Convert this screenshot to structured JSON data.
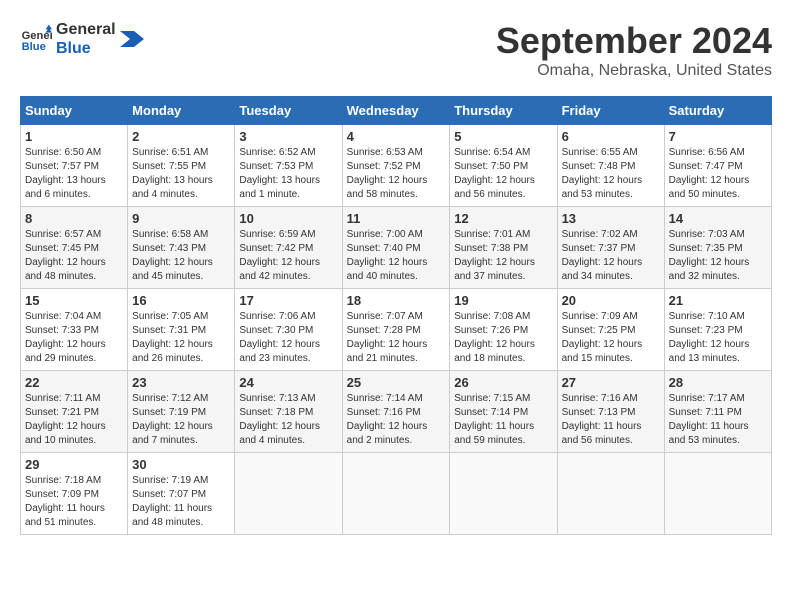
{
  "logo": {
    "line1": "General",
    "line2": "Blue"
  },
  "title": "September 2024",
  "subtitle": "Omaha, Nebraska, United States",
  "headers": [
    "Sunday",
    "Monday",
    "Tuesday",
    "Wednesday",
    "Thursday",
    "Friday",
    "Saturday"
  ],
  "weeks": [
    [
      {
        "day": "1",
        "sunrise": "6:50 AM",
        "sunset": "7:57 PM",
        "daylight": "13 hours and 6 minutes."
      },
      {
        "day": "2",
        "sunrise": "6:51 AM",
        "sunset": "7:55 PM",
        "daylight": "13 hours and 4 minutes."
      },
      {
        "day": "3",
        "sunrise": "6:52 AM",
        "sunset": "7:53 PM",
        "daylight": "13 hours and 1 minute."
      },
      {
        "day": "4",
        "sunrise": "6:53 AM",
        "sunset": "7:52 PM",
        "daylight": "12 hours and 58 minutes."
      },
      {
        "day": "5",
        "sunrise": "6:54 AM",
        "sunset": "7:50 PM",
        "daylight": "12 hours and 56 minutes."
      },
      {
        "day": "6",
        "sunrise": "6:55 AM",
        "sunset": "7:48 PM",
        "daylight": "12 hours and 53 minutes."
      },
      {
        "day": "7",
        "sunrise": "6:56 AM",
        "sunset": "7:47 PM",
        "daylight": "12 hours and 50 minutes."
      }
    ],
    [
      {
        "day": "8",
        "sunrise": "6:57 AM",
        "sunset": "7:45 PM",
        "daylight": "12 hours and 48 minutes."
      },
      {
        "day": "9",
        "sunrise": "6:58 AM",
        "sunset": "7:43 PM",
        "daylight": "12 hours and 45 minutes."
      },
      {
        "day": "10",
        "sunrise": "6:59 AM",
        "sunset": "7:42 PM",
        "daylight": "12 hours and 42 minutes."
      },
      {
        "day": "11",
        "sunrise": "7:00 AM",
        "sunset": "7:40 PM",
        "daylight": "12 hours and 40 minutes."
      },
      {
        "day": "12",
        "sunrise": "7:01 AM",
        "sunset": "7:38 PM",
        "daylight": "12 hours and 37 minutes."
      },
      {
        "day": "13",
        "sunrise": "7:02 AM",
        "sunset": "7:37 PM",
        "daylight": "12 hours and 34 minutes."
      },
      {
        "day": "14",
        "sunrise": "7:03 AM",
        "sunset": "7:35 PM",
        "daylight": "12 hours and 32 minutes."
      }
    ],
    [
      {
        "day": "15",
        "sunrise": "7:04 AM",
        "sunset": "7:33 PM",
        "daylight": "12 hours and 29 minutes."
      },
      {
        "day": "16",
        "sunrise": "7:05 AM",
        "sunset": "7:31 PM",
        "daylight": "12 hours and 26 minutes."
      },
      {
        "day": "17",
        "sunrise": "7:06 AM",
        "sunset": "7:30 PM",
        "daylight": "12 hours and 23 minutes."
      },
      {
        "day": "18",
        "sunrise": "7:07 AM",
        "sunset": "7:28 PM",
        "daylight": "12 hours and 21 minutes."
      },
      {
        "day": "19",
        "sunrise": "7:08 AM",
        "sunset": "7:26 PM",
        "daylight": "12 hours and 18 minutes."
      },
      {
        "day": "20",
        "sunrise": "7:09 AM",
        "sunset": "7:25 PM",
        "daylight": "12 hours and 15 minutes."
      },
      {
        "day": "21",
        "sunrise": "7:10 AM",
        "sunset": "7:23 PM",
        "daylight": "12 hours and 13 minutes."
      }
    ],
    [
      {
        "day": "22",
        "sunrise": "7:11 AM",
        "sunset": "7:21 PM",
        "daylight": "12 hours and 10 minutes."
      },
      {
        "day": "23",
        "sunrise": "7:12 AM",
        "sunset": "7:19 PM",
        "daylight": "12 hours and 7 minutes."
      },
      {
        "day": "24",
        "sunrise": "7:13 AM",
        "sunset": "7:18 PM",
        "daylight": "12 hours and 4 minutes."
      },
      {
        "day": "25",
        "sunrise": "7:14 AM",
        "sunset": "7:16 PM",
        "daylight": "12 hours and 2 minutes."
      },
      {
        "day": "26",
        "sunrise": "7:15 AM",
        "sunset": "7:14 PM",
        "daylight": "11 hours and 59 minutes."
      },
      {
        "day": "27",
        "sunrise": "7:16 AM",
        "sunset": "7:13 PM",
        "daylight": "11 hours and 56 minutes."
      },
      {
        "day": "28",
        "sunrise": "7:17 AM",
        "sunset": "7:11 PM",
        "daylight": "11 hours and 53 minutes."
      }
    ],
    [
      {
        "day": "29",
        "sunrise": "7:18 AM",
        "sunset": "7:09 PM",
        "daylight": "11 hours and 51 minutes."
      },
      {
        "day": "30",
        "sunrise": "7:19 AM",
        "sunset": "7:07 PM",
        "daylight": "11 hours and 48 minutes."
      },
      null,
      null,
      null,
      null,
      null
    ]
  ]
}
